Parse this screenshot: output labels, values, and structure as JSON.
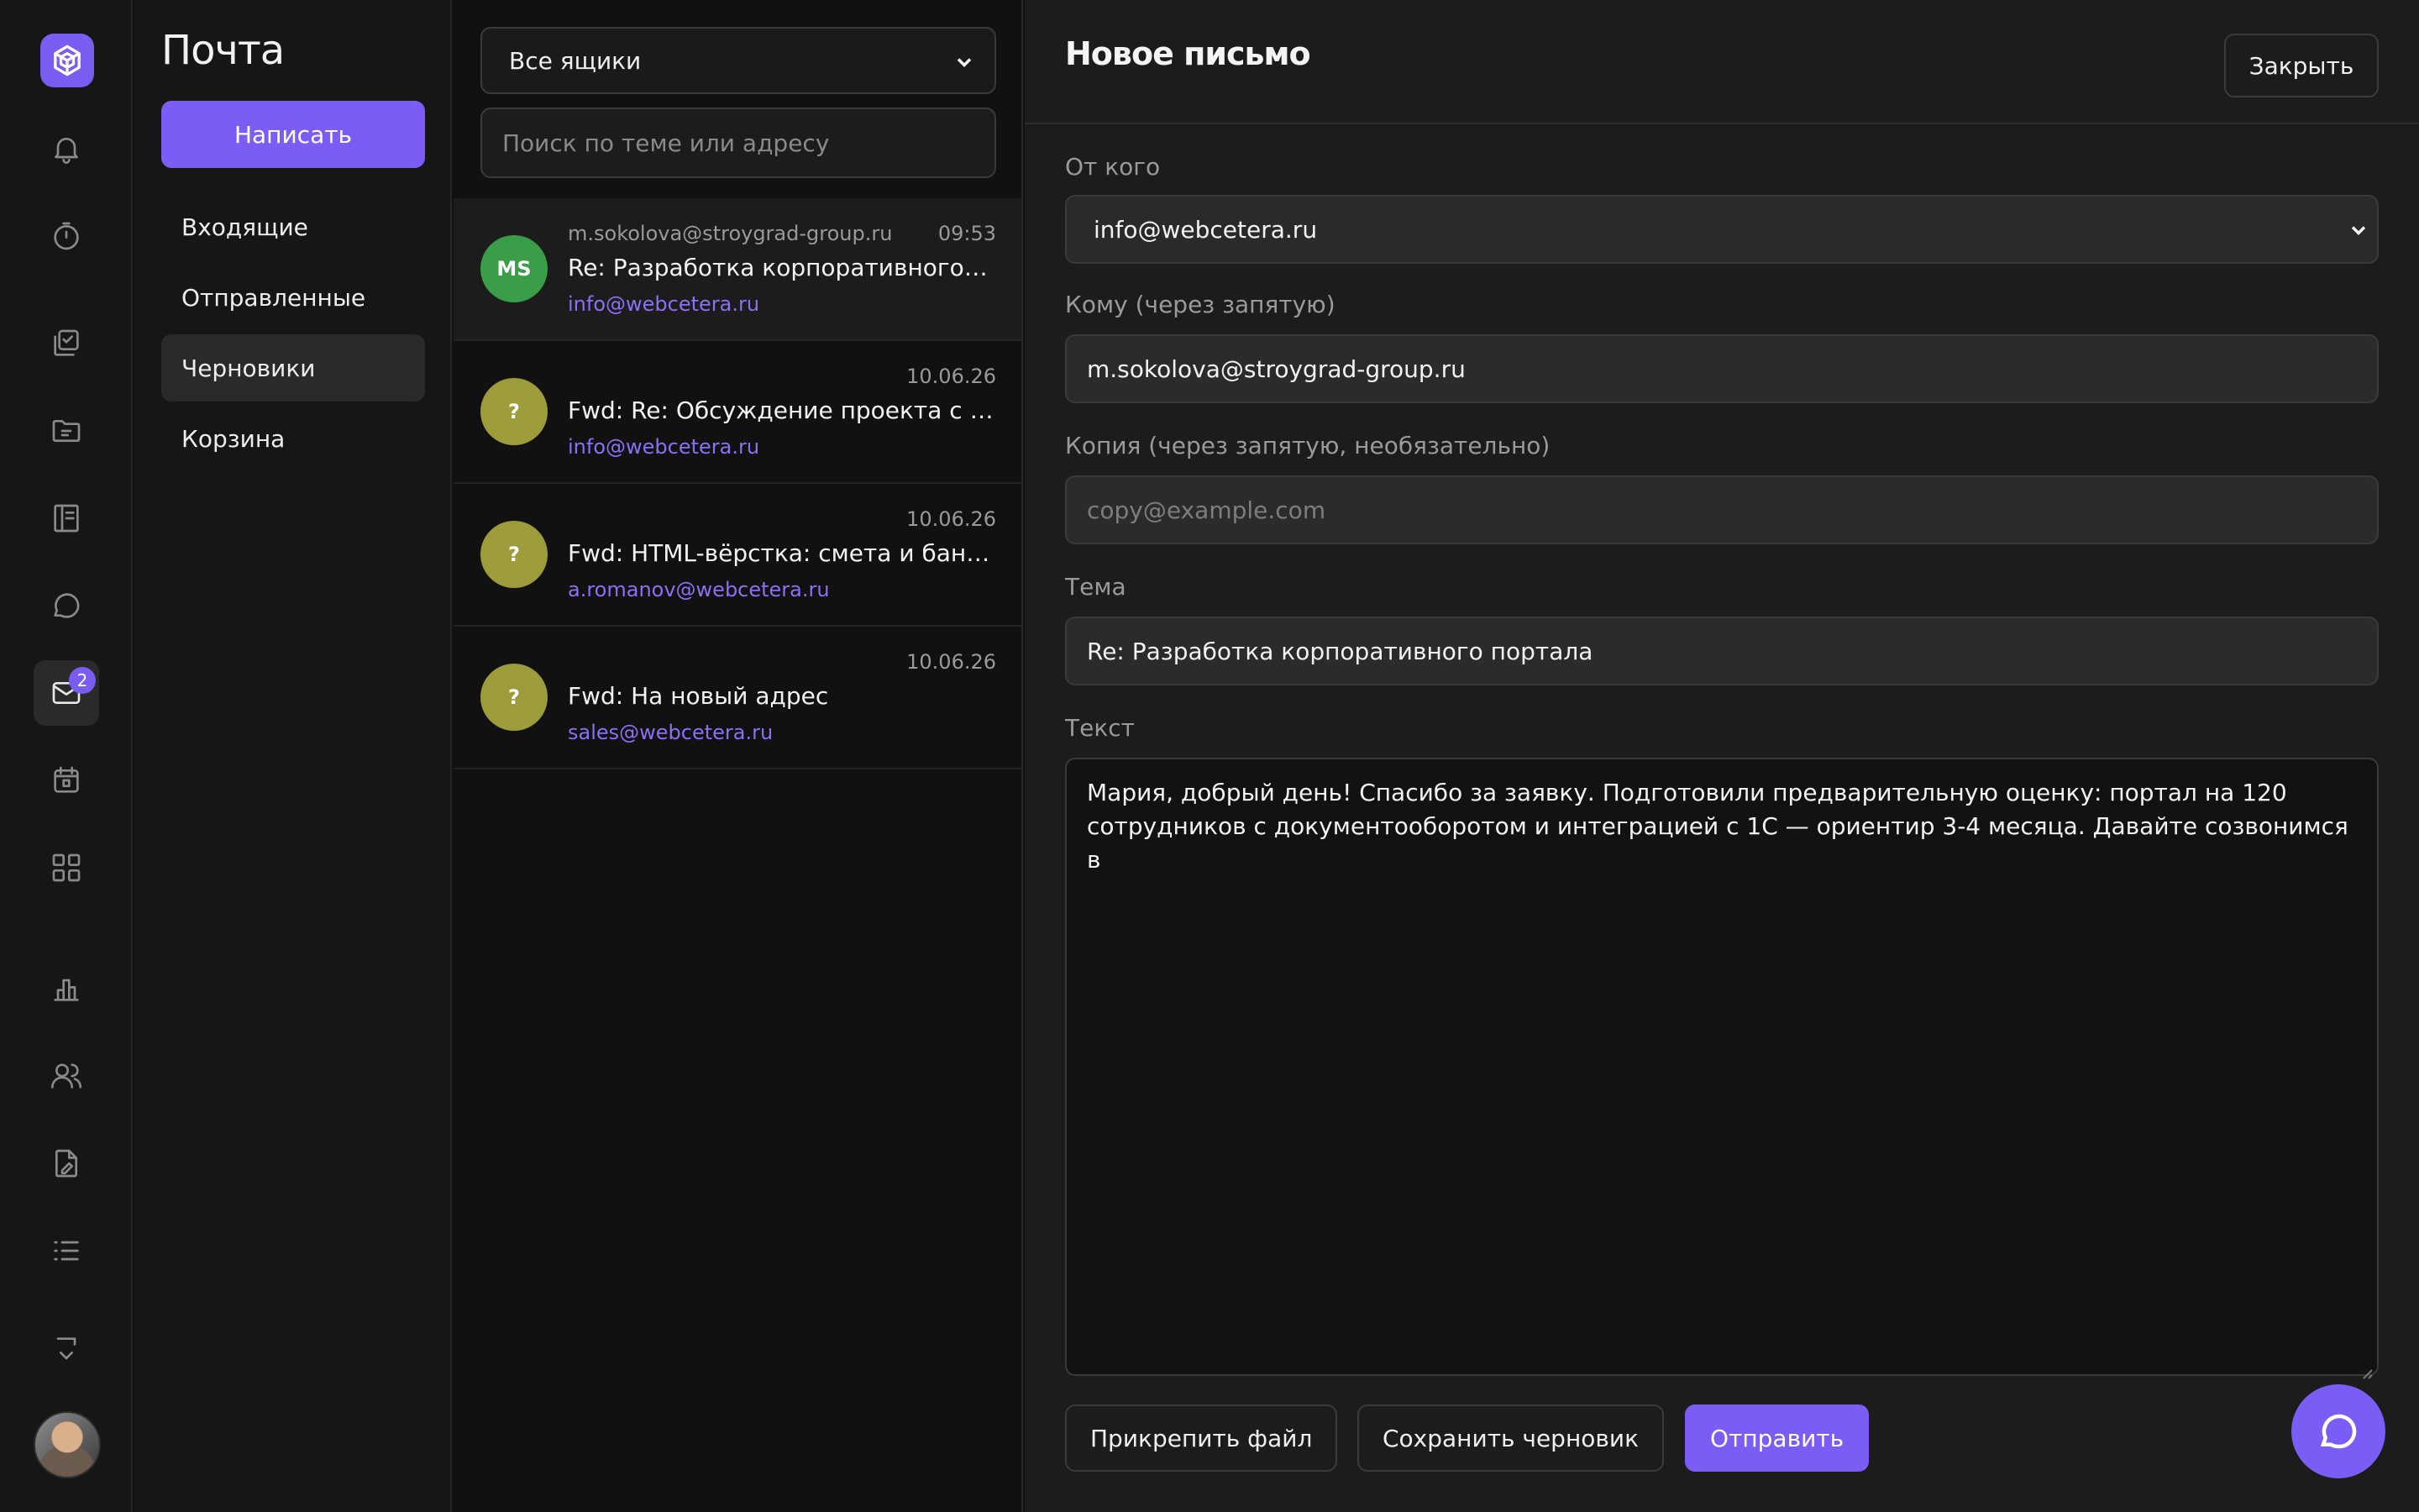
{
  "rail": {
    "icons": [
      "logo-icon",
      "bell-icon",
      "timer-icon",
      "tasks-icon",
      "folder-icon",
      "notebook-icon",
      "chat-icon",
      "mail-icon",
      "calendar-icon",
      "apps-icon",
      "chart-icon",
      "users-icon",
      "file-edit-icon",
      "list-icon",
      "expand-icon"
    ],
    "mail_badge": "2"
  },
  "mailnav": {
    "title": "Почта",
    "compose_label": "Написать",
    "folders": [
      {
        "label": "Входящие",
        "active": false
      },
      {
        "label": "Отправленные",
        "active": false
      },
      {
        "label": "Черновики",
        "active": true
      },
      {
        "label": "Корзина",
        "active": false
      }
    ]
  },
  "list": {
    "mailbox_select": "Все ящики",
    "search_placeholder": "Поиск по теме или адресу",
    "messages": [
      {
        "initials": "MS",
        "avatar_color": "#3a9d48",
        "from": "m.sokolova@stroygrad-group.ru",
        "time": "09:53",
        "subject": "Re: Разработка корпоративного портала",
        "to": "info@webcetera.ru",
        "active": true
      },
      {
        "initials": "?",
        "avatar_color": "#9c9c3a",
        "from": "",
        "time": "10.06.26",
        "subject": "Fwd: Re: Обсуждение проекта с клиентом",
        "to": "info@webcetera.ru",
        "active": false
      },
      {
        "initials": "?",
        "avatar_color": "#9c9c3a",
        "from": "",
        "time": "10.06.26",
        "subject": "Fwd: HTML-вёрстка: смета и банковские реквизиты",
        "to": "a.romanov@webcetera.ru",
        "active": false
      },
      {
        "initials": "?",
        "avatar_color": "#9c9c3a",
        "from": "",
        "time": "10.06.26",
        "subject": "Fwd: На новый адрес",
        "to": "sales@webcetera.ru",
        "active": false
      }
    ]
  },
  "compose": {
    "title": "Новое письмо",
    "close_label": "Закрыть",
    "from_label": "От кого",
    "from_value": "info@webcetera.ru",
    "to_label": "Кому (через запятую)",
    "to_value": "m.sokolova@stroygrad-group.ru",
    "cc_label": "Копия (через запятую, необязательно)",
    "cc_placeholder": "copy@example.com",
    "subject_label": "Тема",
    "subject_value": "Re: Разработка корпоративного портала",
    "body_label": "Текст",
    "body_value": "Мария, добрый день! Спасибо за заявку. Подготовили предварительную оценку: портал на 120 сотрудников с документооборотом и интеграцией с 1С — ориентир 3-4 месяца. Давайте созвонимся в",
    "attach_label": "Прикрепить файл",
    "save_label": "Сохранить черновик",
    "send_label": "Отправить"
  },
  "colors": {
    "accent": "#7b5cf4",
    "link": "#8b6ff5"
  }
}
